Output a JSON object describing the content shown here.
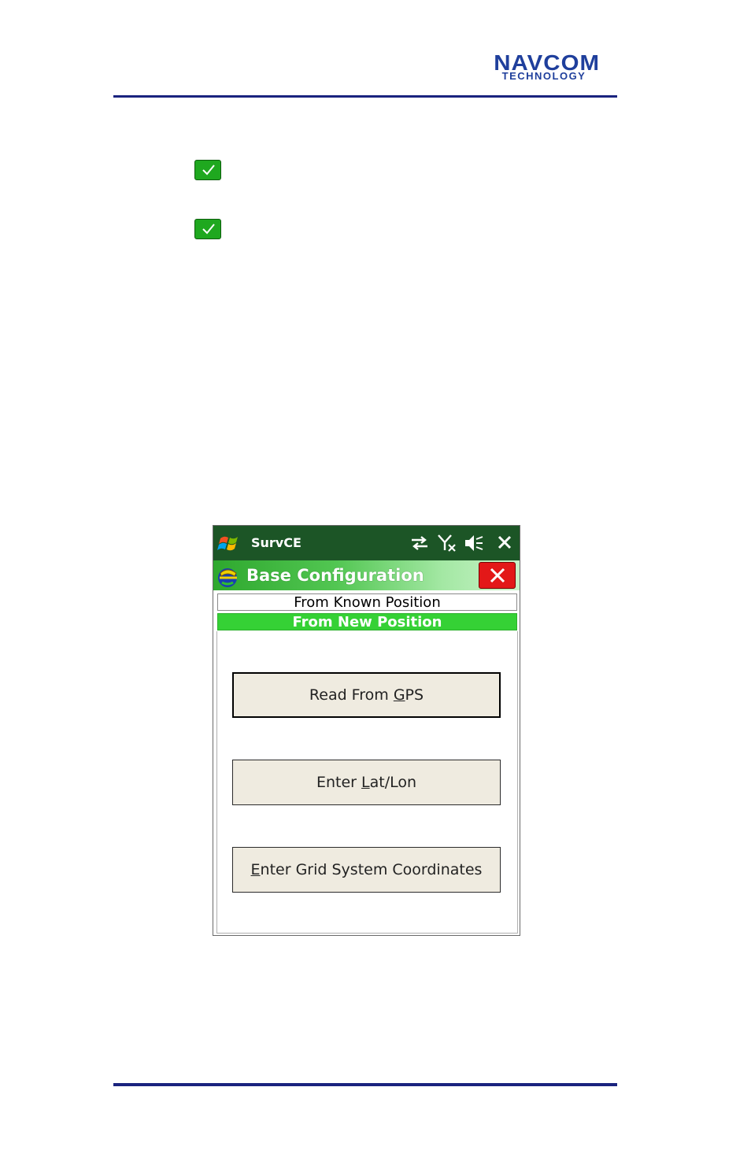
{
  "header": {
    "logo_line1": "NAVCOM",
    "logo_line2": "TECHNOLOGY"
  },
  "colors": {
    "rule": "#1a237e",
    "status_bar": "#1c5526",
    "tab_active": "#35d135",
    "close": "#e31818",
    "check": "#1fa81f"
  },
  "checkmarks": [
    {
      "icon": "check-icon"
    },
    {
      "icon": "check-icon"
    }
  ],
  "device": {
    "status_bar": {
      "title": "SurvCE",
      "icons": [
        "sync-arrows-icon",
        "signal-off-icon",
        "speaker-muted-icon",
        "close-icon"
      ]
    },
    "window": {
      "title": "Base Configuration",
      "close_icon": "close-icon"
    },
    "tabs": [
      {
        "label": "From Known Position",
        "active": false
      },
      {
        "label": "From New Position",
        "active": true
      }
    ],
    "buttons": {
      "read_gps": {
        "pre": "Read From ",
        "mnemonic": "G",
        "post": "PS"
      },
      "enter_latlon": {
        "pre": "Enter ",
        "mnemonic": "L",
        "post": "at/Lon"
      },
      "enter_grid": {
        "pre": "",
        "mnemonic": "E",
        "post": "nter Grid System Coordinates"
      }
    }
  }
}
